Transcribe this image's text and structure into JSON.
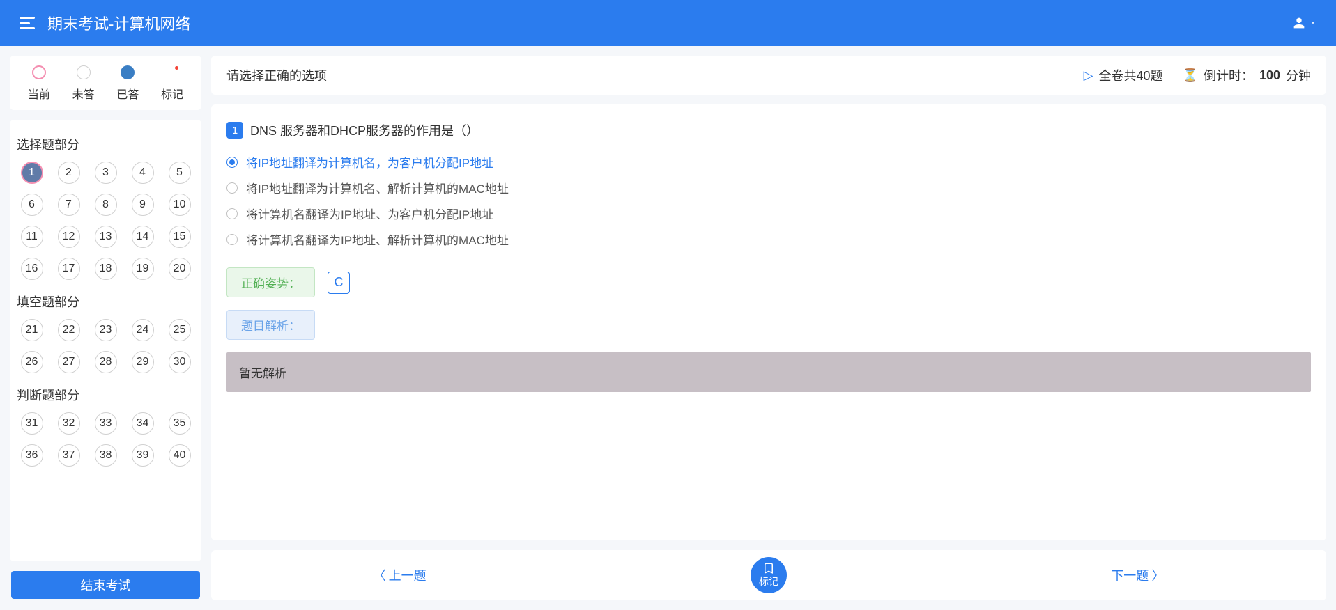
{
  "header": {
    "title": "期末考试-计算机网络"
  },
  "legend": {
    "current": "当前",
    "unanswered": "未答",
    "answered": "已答",
    "marked": "标记"
  },
  "sections": [
    {
      "title": "选择题部分",
      "start": 1,
      "end": 20
    },
    {
      "title": "填空题部分",
      "start": 21,
      "end": 30
    },
    {
      "title": "判断题部分",
      "start": 31,
      "end": 40
    }
  ],
  "currentQuestion": 1,
  "endExamLabel": "结束考试",
  "topbar": {
    "instruction": "请选择正确的选项",
    "totalPrefix": "全卷共",
    "totalCount": "40",
    "totalSuffix": "题",
    "timerLabel": "倒计时：",
    "timerValue": "100",
    "timerUnit": "分钟"
  },
  "question": {
    "number": "1",
    "text": "DNS 服务器和DHCP服务器的作用是（）",
    "options": [
      "将IP地址翻译为计算机名，为客户机分配IP地址",
      "将IP地址翻译为计算机名、解析计算机的MAC地址",
      "将计算机名翻译为IP地址、为客户机分配IP地址",
      "将计算机名翻译为IP地址、解析计算机的MAC地址"
    ],
    "selectedIndex": 0,
    "correctLabel": "正确姿势：",
    "correctAnswer": "C",
    "analysisLabel": "题目解析：",
    "analysisText": "暂无解析"
  },
  "footer": {
    "prev": "上一题",
    "next": "下一题",
    "mark": "标记"
  }
}
